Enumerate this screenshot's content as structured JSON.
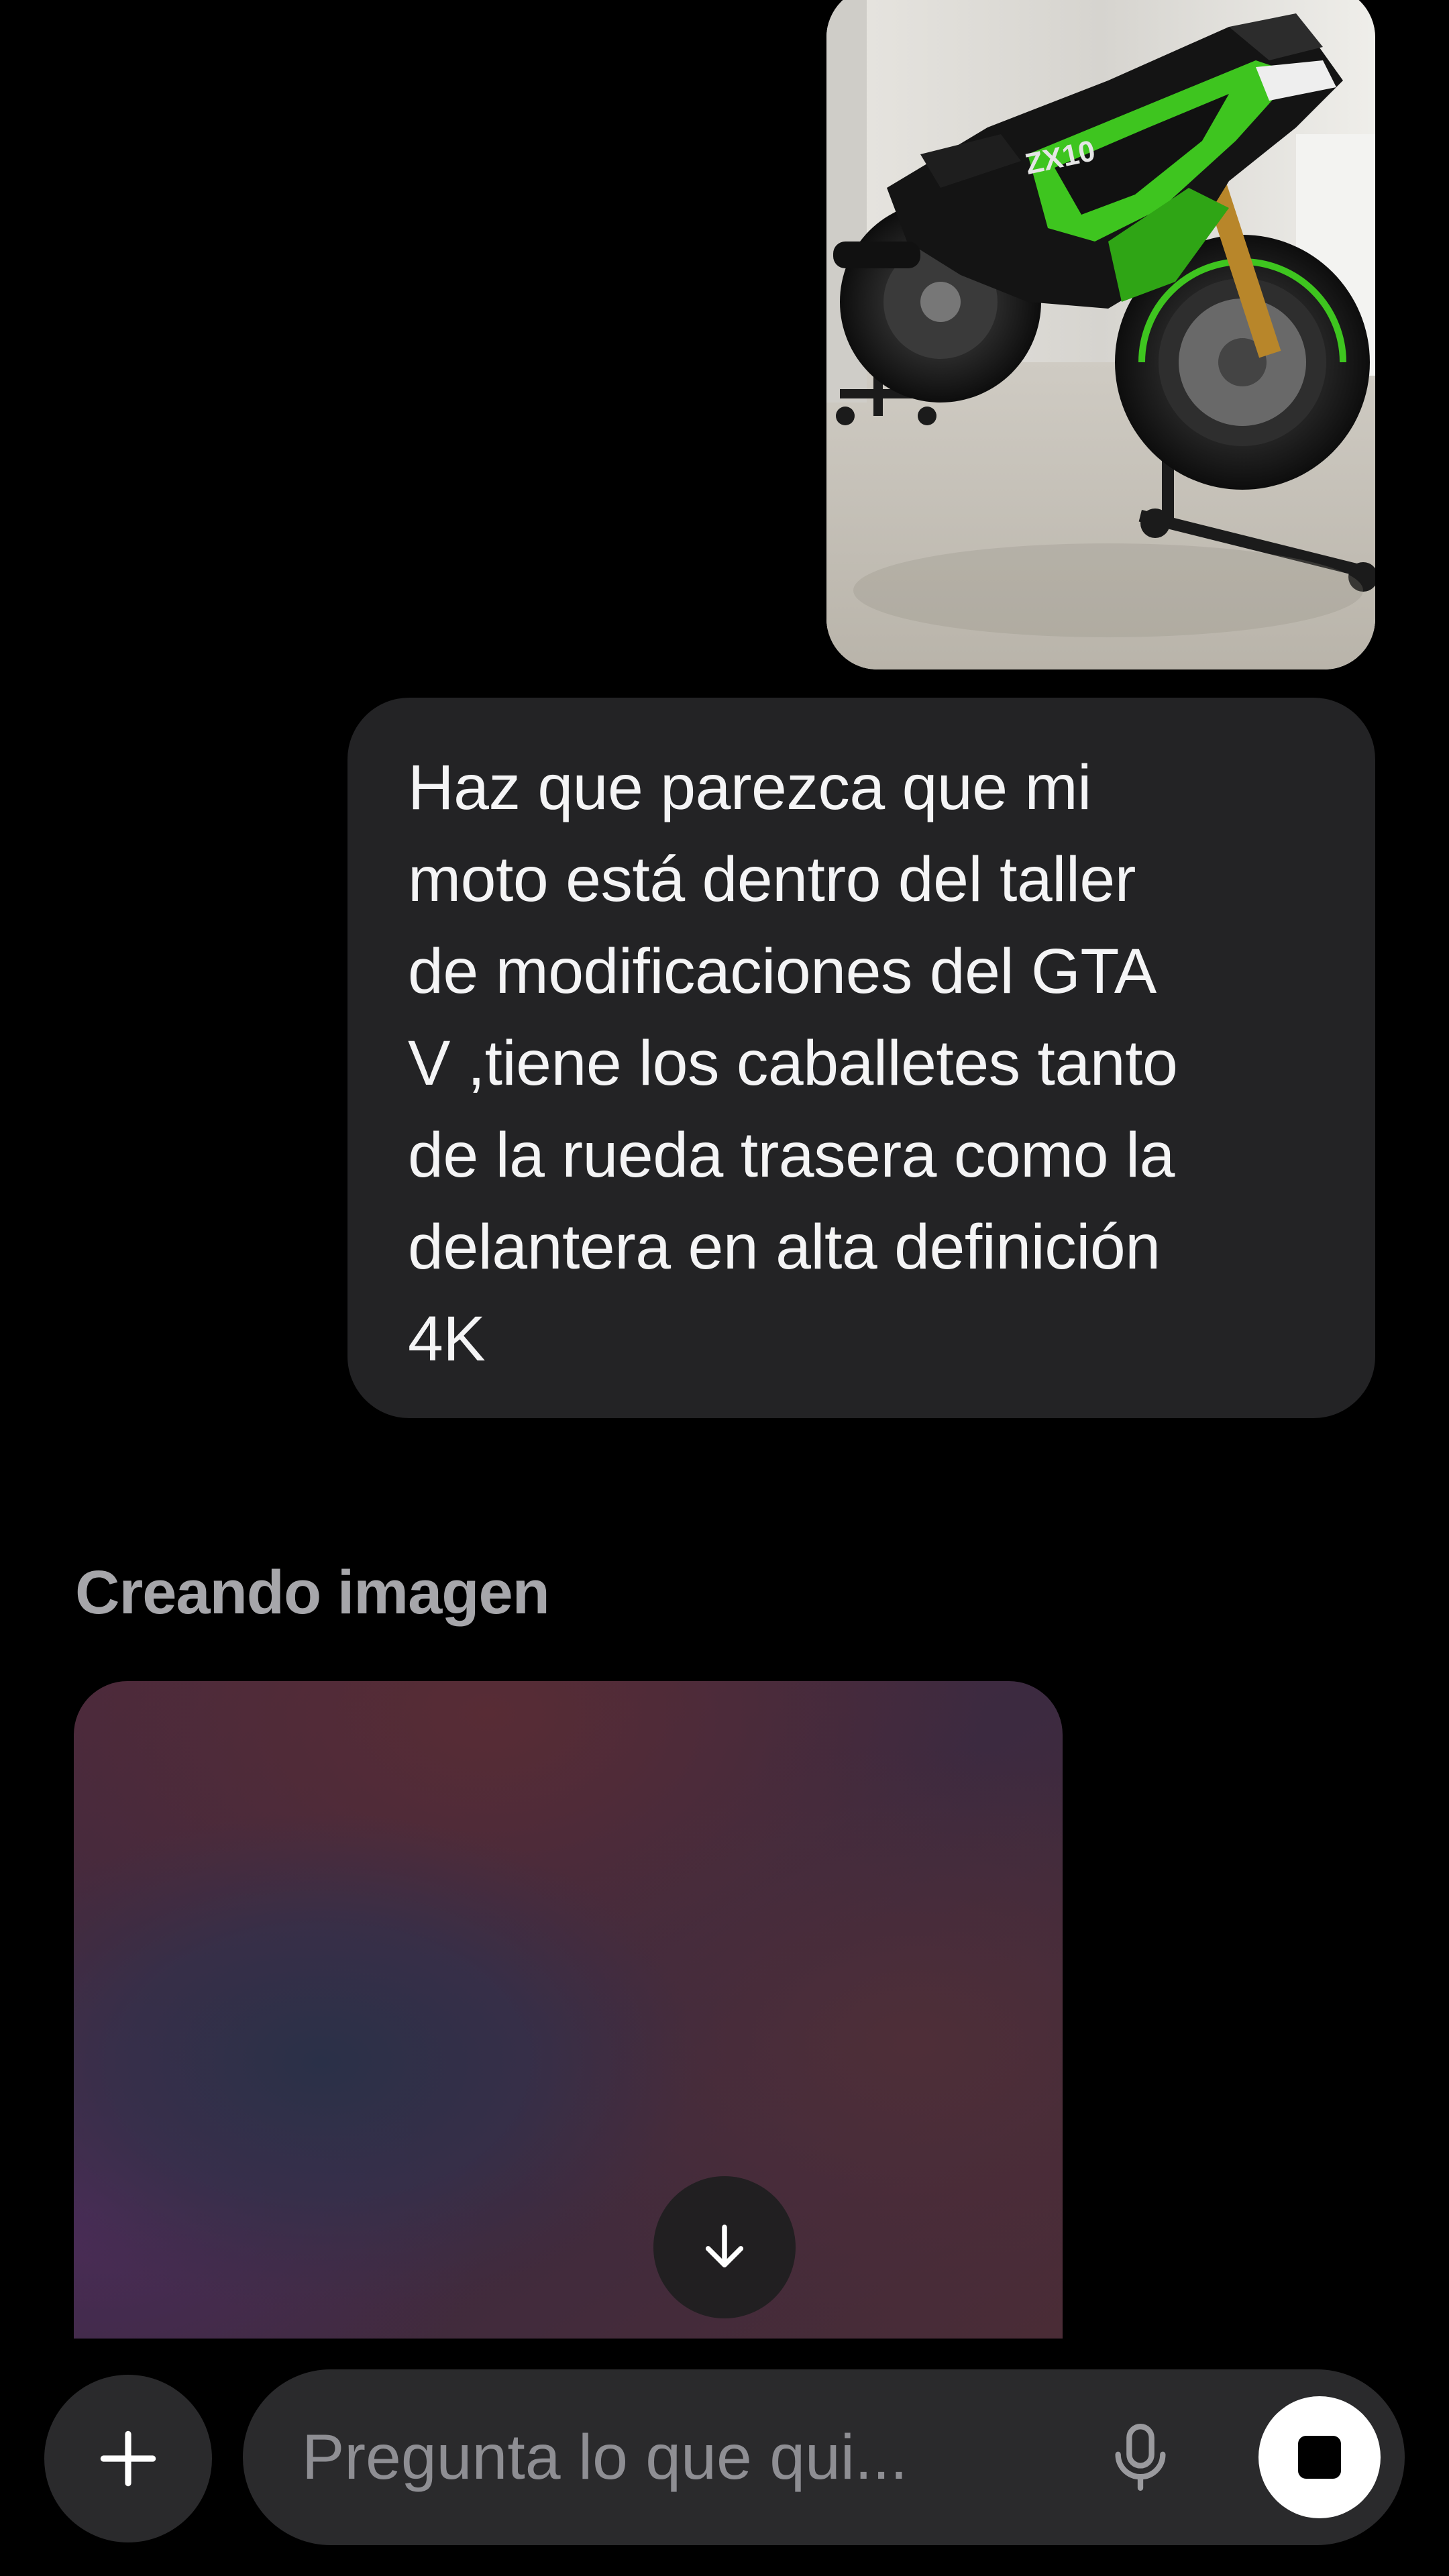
{
  "conversation": {
    "user_image": {
      "alt": "Motocicleta deportiva verde y negra sobre caballetes",
      "badge_text": "ZX10"
    },
    "user_message": "Haz que parezca que mi\nmoto está dentro del taller\nde modificaciones del GTA\nV ,tiene los caballetes tanto\nde la rueda trasera como la\ndelantera en alta definición\n4K",
    "assistant_status": "Creando imagen"
  },
  "composer": {
    "placeholder": "Pregunta lo que qui..."
  },
  "icons": {
    "add": "plus-icon",
    "scroll": "arrow-down-icon",
    "mic": "microphone-icon",
    "stop": "stop-icon"
  },
  "colors": {
    "background": "#000000",
    "user_bubble": "#232325",
    "composer": "#2a2a2c",
    "status_text": "#a6a6aa",
    "motorcycle_accent": "#3ec51f"
  }
}
